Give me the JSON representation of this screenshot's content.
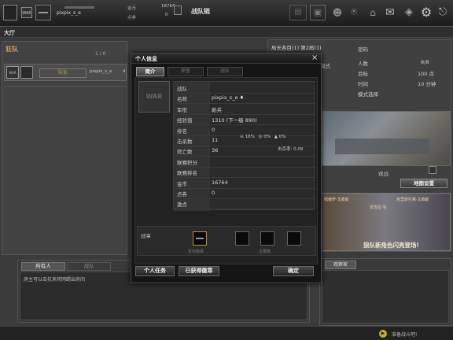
{
  "topbar": {
    "logo": "WAR",
    "player_name": "pixpix_s_e",
    "gold_label": "金币",
    "gold_value": "16764",
    "points_label": "点券",
    "points_value": "0",
    "team_link": "战队链"
  },
  "hall": {
    "title": "大厅"
  },
  "left_panel": {
    "header": "狂队",
    "page_indicator": "1 / 0",
    "member_name": "pixpix_s_e",
    "member_rank": "队长",
    "member_flag": "4"
  },
  "right_panel": {
    "room_title": "局长各目(1) 第2局(1)",
    "mode_label": "...模式",
    "info_rows": [
      {
        "label": "密码",
        "value": ""
      },
      {
        "label": "人数",
        "value": "8/8"
      },
      {
        "label": "目标",
        "value": "100 点"
      },
      {
        "label": "时间",
        "value": "10 分钟"
      },
      {
        "label": "模式选择",
        "value": ""
      }
    ],
    "spectate_label": "观战",
    "map_settings": "地图设置",
    "ad_char_left": "佩德罗·戈麦斯",
    "ad_char_mid": "安吉拉·毛",
    "ad_char_right": "克里斯托弗·文森斯",
    "ad_slogan": "狼队新角色闪亮登场!"
  },
  "dialog": {
    "title": "个人信息",
    "close": "×",
    "tabs": [
      "简介",
      "荣誉",
      "战队"
    ],
    "avatar": "WAR",
    "fields": [
      {
        "label": "战队",
        "value": ""
      },
      {
        "label": "名称",
        "value": "pixpix_s_e  ♦"
      },
      {
        "label": "军衔",
        "value": "新兵"
      },
      {
        "label": "经验值",
        "value": "1310  (下一级 890)"
      },
      {
        "label": "排名",
        "value": "0"
      },
      {
        "label": "击杀数",
        "value": "11"
      },
      {
        "label": "死亡数",
        "value": "36"
      },
      {
        "label": "联赛积分",
        "value": ""
      },
      {
        "label": "联赛排名",
        "value": ""
      },
      {
        "label": "金币",
        "value": "16764"
      },
      {
        "label": "点券",
        "value": "0"
      },
      {
        "label": "激点",
        "value": ""
      }
    ],
    "kill_stats": [
      "18%",
      "0%",
      "0%"
    ],
    "kd_ratio": "击杀率: 0.09",
    "badge_section_label": "勋章",
    "badge_caption_left": "军衔徽章",
    "badge_caption_right": "主徽章",
    "buttons": {
      "personal_task": "个人任务",
      "earned_badges": "已获得徽章",
      "confirm": "确定"
    }
  },
  "chat": {
    "tabs": [
      "所有人",
      "战队"
    ],
    "message": "房主可以击抗来将网踢出房间",
    "room_tab": "观察家"
  },
  "footer": {
    "status": "准备战斗吧!"
  }
}
